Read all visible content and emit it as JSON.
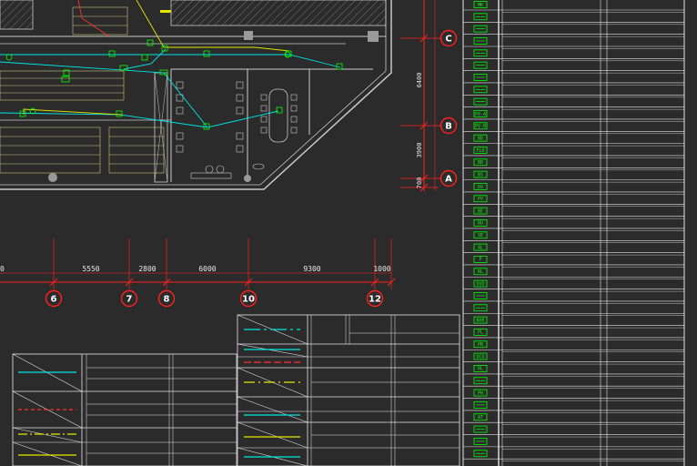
{
  "colors": {
    "background": "#2b2b2b",
    "wall": "#c8c8c8",
    "furniture": "#c8c87a",
    "device": "#00ff00",
    "cable_cyan": "#00e5e5",
    "cable_yellow": "#e5e500",
    "cable_red": "#ff3030",
    "dimension": "#ff2020",
    "table_line": "#e6e6e6",
    "grid_bubble": "#ff2020"
  },
  "grid_axes": {
    "horizontal": [
      {
        "label": "C"
      },
      {
        "label": "B"
      },
      {
        "label": "A"
      }
    ],
    "vertical": [
      {
        "label": "6"
      },
      {
        "label": "7"
      },
      {
        "label": "8"
      },
      {
        "label": "10"
      },
      {
        "label": "12"
      }
    ]
  },
  "dimensions": {
    "horizontal": [
      "0",
      "5550",
      "2800",
      "6000",
      "9300",
      "1000"
    ],
    "vertical": [
      "6400",
      "3900",
      "700"
    ]
  },
  "legend_symbols": [
    "MK",
    "PV-A",
    "PV-B",
    "BD",
    "FLD",
    "BD",
    "BS",
    "DV",
    "PV",
    "BE",
    "BU",
    "SE",
    "AL",
    "P",
    "RL",
    "DVD",
    "NVR",
    "PL",
    "PB",
    "DCU",
    "RL",
    "PH",
    "AT"
  ]
}
